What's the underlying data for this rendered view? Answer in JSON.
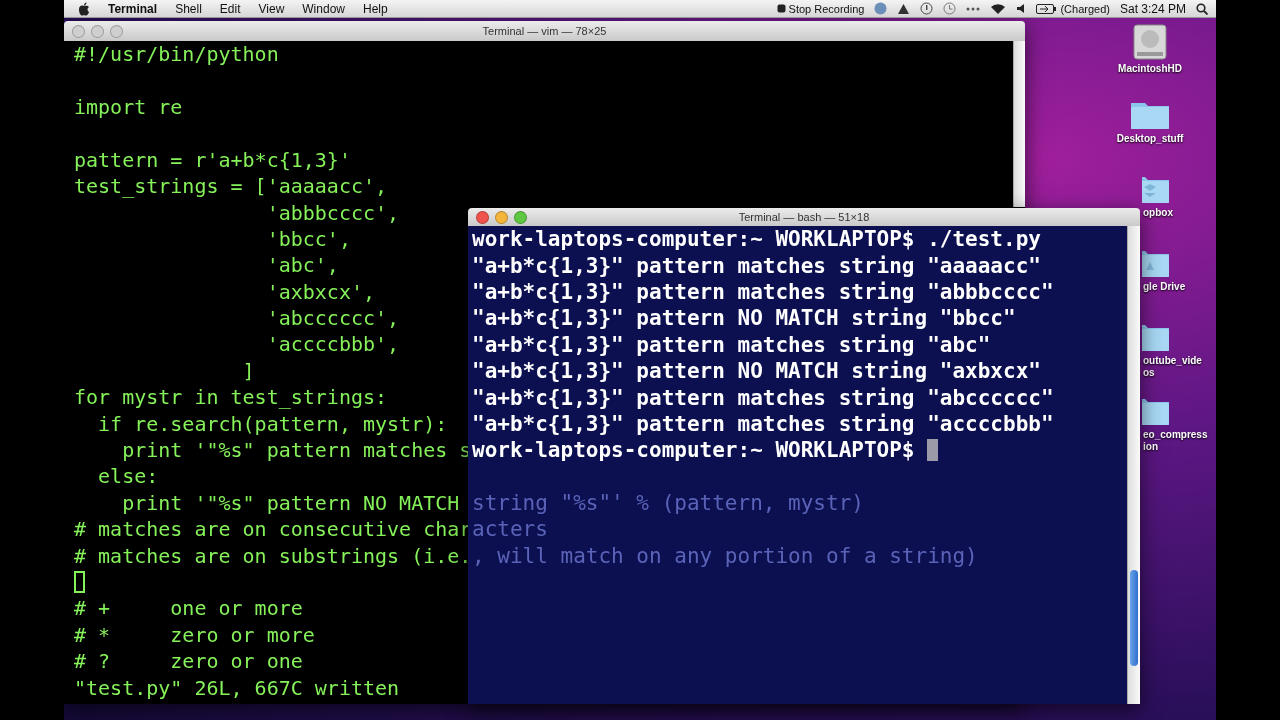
{
  "menu_bar": {
    "app": "Terminal",
    "menus": [
      "Shell",
      "Edit",
      "View",
      "Window",
      "Help"
    ],
    "recording": "Stop Recording",
    "battery": "(Charged)",
    "clock": "Sat 3:24 PM"
  },
  "vim_window": {
    "title": "Terminal — vim — 78×25",
    "lines": [
      {
        "kind": "text",
        "text": "#!/usr/bin/python"
      },
      {
        "kind": "blank"
      },
      {
        "kind": "text",
        "text": "import re"
      },
      {
        "kind": "blank"
      },
      {
        "kind": "text",
        "text": "pattern = r'a+b*c{1,3}'"
      },
      {
        "kind": "text",
        "text": "test_strings = ['aaaaacc',"
      },
      {
        "kind": "text",
        "text": "                'abbbcccc',"
      },
      {
        "kind": "text",
        "text": "                'bbcc',"
      },
      {
        "kind": "text",
        "text": "                'abc',"
      },
      {
        "kind": "text",
        "text": "                'axbxcx',"
      },
      {
        "kind": "text",
        "text": "                'abcccccc',"
      },
      {
        "kind": "text",
        "text": "                'accccbbb',"
      },
      {
        "kind": "text",
        "text": "              ]"
      },
      {
        "kind": "text",
        "text": "for mystr in test_strings:"
      },
      {
        "kind": "text",
        "text": "  if re.search(pattern, mystr):"
      },
      {
        "kind": "text",
        "text": "    print '\"%s\" pattern matches s"
      },
      {
        "kind": "text",
        "text": "  else:"
      },
      {
        "kind": "text",
        "text": "    print '\"%s\" pattern NO MATCH"
      },
      {
        "kind": "text",
        "text": "# matches are on consecutive char"
      },
      {
        "kind": "text",
        "text": "# matches are on substrings (i.e."
      },
      {
        "kind": "cursor"
      },
      {
        "kind": "text",
        "text": "# +     one or more"
      },
      {
        "kind": "text",
        "text": "# *     zero or more"
      },
      {
        "kind": "text",
        "text": "# ?     zero or one"
      },
      {
        "kind": "text",
        "text": "\"test.py\" 26L, 667C written"
      }
    ]
  },
  "bash_window": {
    "title": "Terminal — bash — 51×18",
    "lines": [
      {
        "kind": "text",
        "text": "work-laptops-computer:~ WORKLAPTOP$ ./test.py"
      },
      {
        "kind": "text",
        "text": "\"a+b*c{1,3}\" pattern matches string \"aaaaacc\""
      },
      {
        "kind": "text",
        "text": "\"a+b*c{1,3}\" pattern matches string \"abbbcccc\""
      },
      {
        "kind": "text",
        "text": "\"a+b*c{1,3}\" pattern NO MATCH string \"bbcc\""
      },
      {
        "kind": "text",
        "text": "\"a+b*c{1,3}\" pattern matches string \"abc\""
      },
      {
        "kind": "text",
        "text": "\"a+b*c{1,3}\" pattern NO MATCH string \"axbxcx\""
      },
      {
        "kind": "text",
        "text": "\"a+b*c{1,3}\" pattern matches string \"abcccccc\""
      },
      {
        "kind": "text",
        "text": "\"a+b*c{1,3}\" pattern matches string \"accccbbb\""
      },
      {
        "kind": "prompt",
        "text": "work-laptops-computer:~ WORKLAPTOP$"
      },
      {
        "kind": "blank"
      },
      {
        "kind": "faded",
        "text": "string \"%s\"' % (pattern, mystr)"
      },
      {
        "kind": "faded",
        "text": "acters"
      },
      {
        "kind": "faded",
        "text": ", will match on any portion of a string)"
      }
    ]
  },
  "desktop_icons": [
    {
      "kind": "drive",
      "covered": false,
      "label": [
        "MacintoshHD"
      ]
    },
    {
      "kind": "folder",
      "covered": false,
      "label": [
        "Desktop_stuff"
      ]
    },
    {
      "kind": "dropbox",
      "covered": true,
      "label": [
        "opbox"
      ]
    },
    {
      "kind": "gdrive",
      "covered": true,
      "label": [
        "gle Drive"
      ]
    },
    {
      "kind": "folder",
      "covered": true,
      "label": [
        "outube_vide",
        "os"
      ]
    },
    {
      "kind": "folder",
      "covered": true,
      "label": [
        "eo_compress",
        "ion"
      ]
    }
  ]
}
